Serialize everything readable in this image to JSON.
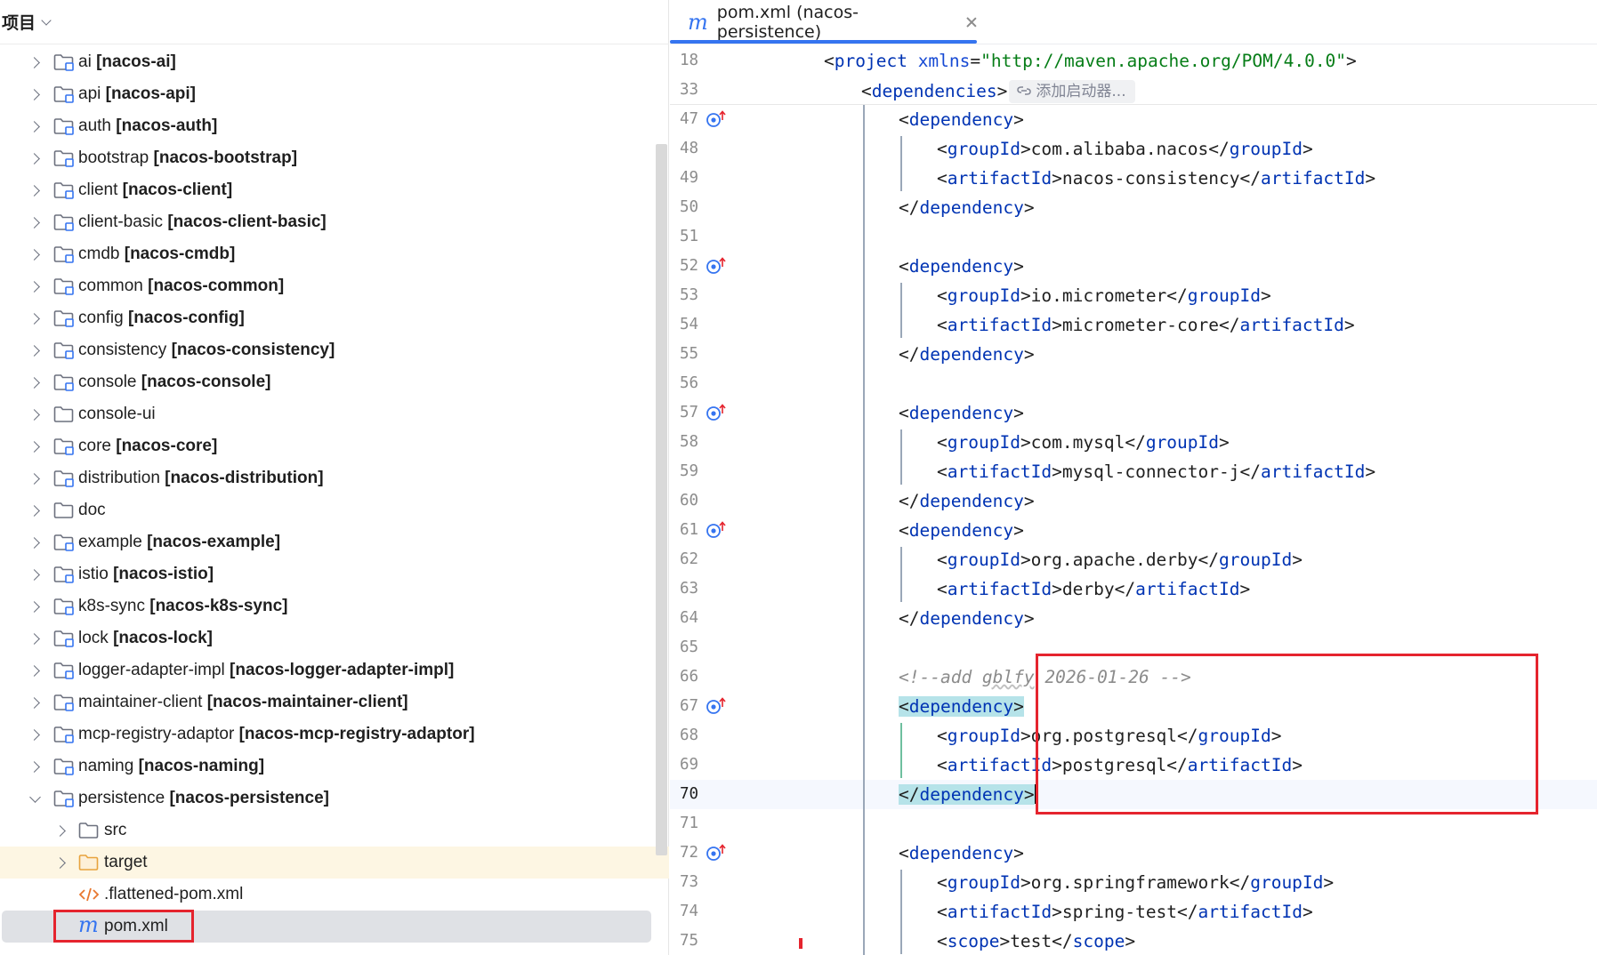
{
  "project_panel": {
    "title": "项目",
    "items": [
      {
        "name": "ai",
        "module": "[nacos-ai]",
        "expanded": false,
        "level": 0,
        "icon": "module-folder-icon"
      },
      {
        "name": "api",
        "module": "[nacos-api]",
        "expanded": false,
        "level": 0,
        "icon": "module-folder-icon"
      },
      {
        "name": "auth",
        "module": "[nacos-auth]",
        "expanded": false,
        "level": 0,
        "icon": "module-folder-icon"
      },
      {
        "name": "bootstrap",
        "module": "[nacos-bootstrap]",
        "expanded": false,
        "level": 0,
        "icon": "module-folder-icon"
      },
      {
        "name": "client",
        "module": "[nacos-client]",
        "expanded": false,
        "level": 0,
        "icon": "module-folder-icon"
      },
      {
        "name": "client-basic",
        "module": "[nacos-client-basic]",
        "expanded": false,
        "level": 0,
        "icon": "module-folder-icon"
      },
      {
        "name": "cmdb",
        "module": "[nacos-cmdb]",
        "expanded": false,
        "level": 0,
        "icon": "module-folder-icon"
      },
      {
        "name": "common",
        "module": "[nacos-common]",
        "expanded": false,
        "level": 0,
        "icon": "module-folder-icon"
      },
      {
        "name": "config",
        "module": "[nacos-config]",
        "expanded": false,
        "level": 0,
        "icon": "module-folder-icon"
      },
      {
        "name": "consistency",
        "module": "[nacos-consistency]",
        "expanded": false,
        "level": 0,
        "icon": "module-folder-icon"
      },
      {
        "name": "console",
        "module": "[nacos-console]",
        "expanded": false,
        "level": 0,
        "icon": "module-folder-icon"
      },
      {
        "name": "console-ui",
        "module": "",
        "expanded": false,
        "level": 0,
        "icon": "folder-icon"
      },
      {
        "name": "core",
        "module": "[nacos-core]",
        "expanded": false,
        "level": 0,
        "icon": "module-folder-icon"
      },
      {
        "name": "distribution",
        "module": "[nacos-distribution]",
        "expanded": false,
        "level": 0,
        "icon": "module-folder-icon"
      },
      {
        "name": "doc",
        "module": "",
        "expanded": false,
        "level": 0,
        "icon": "folder-icon"
      },
      {
        "name": "example",
        "module": "[nacos-example]",
        "expanded": false,
        "level": 0,
        "icon": "module-folder-icon"
      },
      {
        "name": "istio",
        "module": "[nacos-istio]",
        "expanded": false,
        "level": 0,
        "icon": "module-folder-icon"
      },
      {
        "name": "k8s-sync",
        "module": "[nacos-k8s-sync]",
        "expanded": false,
        "level": 0,
        "icon": "module-folder-icon"
      },
      {
        "name": "lock",
        "module": "[nacos-lock]",
        "expanded": false,
        "level": 0,
        "icon": "module-folder-icon"
      },
      {
        "name": "logger-adapter-impl",
        "module": "[nacos-logger-adapter-impl]",
        "expanded": false,
        "level": 0,
        "icon": "module-folder-icon"
      },
      {
        "name": "maintainer-client",
        "module": "[nacos-maintainer-client]",
        "expanded": false,
        "level": 0,
        "icon": "module-folder-icon"
      },
      {
        "name": "mcp-registry-adaptor",
        "module": "[nacos-mcp-registry-adaptor]",
        "expanded": false,
        "level": 0,
        "icon": "module-folder-icon"
      },
      {
        "name": "naming",
        "module": "[nacos-naming]",
        "expanded": false,
        "level": 0,
        "icon": "module-folder-icon"
      },
      {
        "name": "persistence",
        "module": "[nacos-persistence]",
        "expanded": true,
        "level": 0,
        "icon": "module-folder-icon"
      },
      {
        "name": "src",
        "module": "",
        "expanded": false,
        "level": 1,
        "icon": "folder-icon"
      },
      {
        "name": "target",
        "module": "",
        "expanded": false,
        "level": 1,
        "icon": "excluded-folder-icon",
        "highlight": "yellow"
      },
      {
        "name": ".flattened-pom.xml",
        "module": "",
        "level": 1,
        "icon": "xml-file-icon",
        "leaf": true
      },
      {
        "name": "pom.xml",
        "module": "",
        "level": 1,
        "icon": "maven-file-icon",
        "leaf": true,
        "selected": true
      }
    ]
  },
  "editor": {
    "tab": {
      "icon": "maven-file-icon",
      "label": "pom.xml (nacos-persistence)"
    },
    "sticky_lines": [
      {
        "num": "18",
        "tokens": [
          [
            "br",
            "<"
          ],
          [
            "tag",
            "project"
          ],
          [
            "br",
            " "
          ],
          [
            "attr",
            "xmlns"
          ],
          [
            "br",
            "="
          ],
          [
            "val",
            "\"http://maven.apache.org/POM/4.0.0\""
          ],
          [
            "br",
            ">"
          ]
        ],
        "indent": 2
      },
      {
        "num": "33",
        "tokens": [
          [
            "br",
            "<"
          ],
          [
            "tag",
            "dependencies"
          ],
          [
            "br",
            ">"
          ]
        ],
        "indent": 3,
        "hint": "添加启动器..."
      }
    ],
    "lines": [
      {
        "num": "47",
        "gutter": true,
        "indent": 4,
        "tokens": [
          [
            "br",
            "<"
          ],
          [
            "tag",
            "dependency"
          ],
          [
            "br",
            ">"
          ]
        ]
      },
      {
        "num": "48",
        "indent": 5,
        "tokens": [
          [
            "br",
            "<"
          ],
          [
            "tag",
            "groupId"
          ],
          [
            "br",
            ">com.alibaba.nacos</"
          ],
          [
            "tag",
            "groupId"
          ],
          [
            "br",
            ">"
          ]
        ]
      },
      {
        "num": "49",
        "indent": 5,
        "tokens": [
          [
            "br",
            "<"
          ],
          [
            "tag",
            "artifactId"
          ],
          [
            "br",
            ">nacos-consistency</"
          ],
          [
            "tag",
            "artifactId"
          ],
          [
            "br",
            ">"
          ]
        ]
      },
      {
        "num": "50",
        "indent": 4,
        "tokens": [
          [
            "br",
            "</"
          ],
          [
            "tag",
            "dependency"
          ],
          [
            "br",
            ">"
          ]
        ]
      },
      {
        "num": "51",
        "indent": 0,
        "tokens": []
      },
      {
        "num": "52",
        "gutter": true,
        "indent": 4,
        "tokens": [
          [
            "br",
            "<"
          ],
          [
            "tag",
            "dependency"
          ],
          [
            "br",
            ">"
          ]
        ]
      },
      {
        "num": "53",
        "indent": 5,
        "tokens": [
          [
            "br",
            "<"
          ],
          [
            "tag",
            "groupId"
          ],
          [
            "br",
            ">io.micrometer</"
          ],
          [
            "tag",
            "groupId"
          ],
          [
            "br",
            ">"
          ]
        ]
      },
      {
        "num": "54",
        "indent": 5,
        "tokens": [
          [
            "br",
            "<"
          ],
          [
            "tag",
            "artifactId"
          ],
          [
            "br",
            ">micrometer-core</"
          ],
          [
            "tag",
            "artifactId"
          ],
          [
            "br",
            ">"
          ]
        ]
      },
      {
        "num": "55",
        "indent": 4,
        "tokens": [
          [
            "br",
            "</"
          ],
          [
            "tag",
            "dependency"
          ],
          [
            "br",
            ">"
          ]
        ]
      },
      {
        "num": "56",
        "indent": 0,
        "tokens": []
      },
      {
        "num": "57",
        "gutter": true,
        "indent": 4,
        "tokens": [
          [
            "br",
            "<"
          ],
          [
            "tag",
            "dependency"
          ],
          [
            "br",
            ">"
          ]
        ]
      },
      {
        "num": "58",
        "indent": 5,
        "tokens": [
          [
            "br",
            "<"
          ],
          [
            "tag",
            "groupId"
          ],
          [
            "br",
            ">com.mysql</"
          ],
          [
            "tag",
            "groupId"
          ],
          [
            "br",
            ">"
          ]
        ]
      },
      {
        "num": "59",
        "indent": 5,
        "tokens": [
          [
            "br",
            "<"
          ],
          [
            "tag",
            "artifactId"
          ],
          [
            "br",
            ">mysql-connector-j</"
          ],
          [
            "tag",
            "artifactId"
          ],
          [
            "br",
            ">"
          ]
        ]
      },
      {
        "num": "60",
        "indent": 4,
        "tokens": [
          [
            "br",
            "</"
          ],
          [
            "tag",
            "dependency"
          ],
          [
            "br",
            ">"
          ]
        ]
      },
      {
        "num": "61",
        "gutter": true,
        "indent": 4,
        "tokens": [
          [
            "br",
            "<"
          ],
          [
            "tag",
            "dependency"
          ],
          [
            "br",
            ">"
          ]
        ]
      },
      {
        "num": "62",
        "indent": 5,
        "tokens": [
          [
            "br",
            "<"
          ],
          [
            "tag",
            "groupId"
          ],
          [
            "br",
            ">org.apache.derby</"
          ],
          [
            "tag",
            "groupId"
          ],
          [
            "br",
            ">"
          ]
        ]
      },
      {
        "num": "63",
        "indent": 5,
        "tokens": [
          [
            "br",
            "<"
          ],
          [
            "tag",
            "artifactId"
          ],
          [
            "br",
            ">derby</"
          ],
          [
            "tag",
            "artifactId"
          ],
          [
            "br",
            ">"
          ]
        ]
      },
      {
        "num": "64",
        "indent": 4,
        "tokens": [
          [
            "br",
            "</"
          ],
          [
            "tag",
            "dependency"
          ],
          [
            "br",
            ">"
          ]
        ]
      },
      {
        "num": "65",
        "indent": 0,
        "tokens": []
      },
      {
        "num": "66",
        "indent": 4,
        "tokens": [
          [
            "cm",
            "<!--add "
          ],
          [
            "cmu",
            "gblfy"
          ],
          [
            "cm",
            " 2026-01-26 -->"
          ]
        ]
      },
      {
        "num": "67",
        "gutter": true,
        "indent": 4,
        "tokens": [
          [
            "hl",
            "<"
          ],
          [
            "hltag",
            "dependency"
          ],
          [
            "hl",
            ">"
          ]
        ]
      },
      {
        "num": "68",
        "indent": 5,
        "tokens": [
          [
            "br",
            "<"
          ],
          [
            "tag",
            "groupId"
          ],
          [
            "br",
            ">org.postgresql</"
          ],
          [
            "tag",
            "groupId"
          ],
          [
            "br",
            ">"
          ]
        ]
      },
      {
        "num": "69",
        "indent": 5,
        "tokens": [
          [
            "br",
            "<"
          ],
          [
            "tag",
            "artifactId"
          ],
          [
            "br",
            ">postgresql</"
          ],
          [
            "tag",
            "artifactId"
          ],
          [
            "br",
            ">"
          ]
        ]
      },
      {
        "num": "70",
        "indent": 4,
        "current": true,
        "tokens": [
          [
            "hl",
            "</"
          ],
          [
            "hltag",
            "dependency"
          ],
          [
            "hl",
            ">"
          ],
          [
            "caret",
            ""
          ]
        ]
      },
      {
        "num": "71",
        "indent": 0,
        "tokens": []
      },
      {
        "num": "72",
        "gutter": true,
        "indent": 4,
        "tokens": [
          [
            "br",
            "<"
          ],
          [
            "tag",
            "dependency"
          ],
          [
            "br",
            ">"
          ]
        ]
      },
      {
        "num": "73",
        "indent": 5,
        "tokens": [
          [
            "br",
            "<"
          ],
          [
            "tag",
            "groupId"
          ],
          [
            "br",
            ">org.springframework</"
          ],
          [
            "tag",
            "groupId"
          ],
          [
            "br",
            ">"
          ]
        ]
      },
      {
        "num": "74",
        "indent": 5,
        "tokens": [
          [
            "br",
            "<"
          ],
          [
            "tag",
            "artifactId"
          ],
          [
            "br",
            ">spring-test</"
          ],
          [
            "tag",
            "artifactId"
          ],
          [
            "br",
            ">"
          ]
        ]
      },
      {
        "num": "75",
        "indent": 5,
        "tokens": [
          [
            "br",
            "<"
          ],
          [
            "tag",
            "scope"
          ],
          [
            "br",
            ">test</"
          ],
          [
            "tag",
            "scope"
          ],
          [
            "br",
            ">"
          ]
        ]
      }
    ]
  },
  "colors": {
    "accent": "#3574f0",
    "highlight_box": "#e5242e",
    "xml_tag": "#0033b3",
    "xml_value": "#067d17",
    "comment": "#8c8c8c",
    "paren_highlight": "#b6e3e9"
  }
}
